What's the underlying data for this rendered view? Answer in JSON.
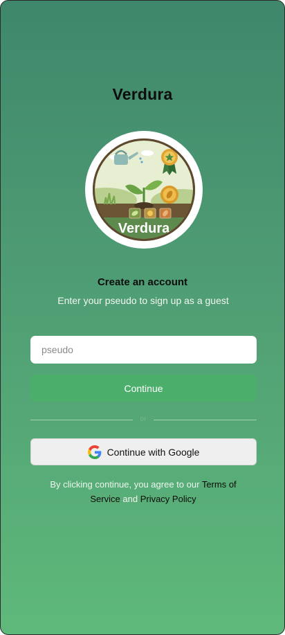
{
  "app": {
    "title": "Verdura"
  },
  "logo": {
    "wordmark": "Verdura"
  },
  "signup": {
    "headline": "Create an account",
    "subline": "Enter your pseudo to sign up as a guest",
    "pseudo_value": "",
    "pseudo_placeholder": "pseudo",
    "continue_label": "Continue",
    "divider_text": "or",
    "google_label": "Continue with Google"
  },
  "legal": {
    "prefix": "By clicking continue, you agree to our",
    "terms_label": "Terms of Service",
    "joiner": "and",
    "privacy_label": "Privacy Policy"
  },
  "colors": {
    "gradient_top": "#3f876b",
    "gradient_bottom": "#5fb97a",
    "primary_button": "#4bae6a",
    "input_bg": "#ffffff",
    "google_button_bg": "#efefef"
  },
  "icons": {
    "google": "google-g-icon",
    "logo": "verdura-garden-logo"
  }
}
